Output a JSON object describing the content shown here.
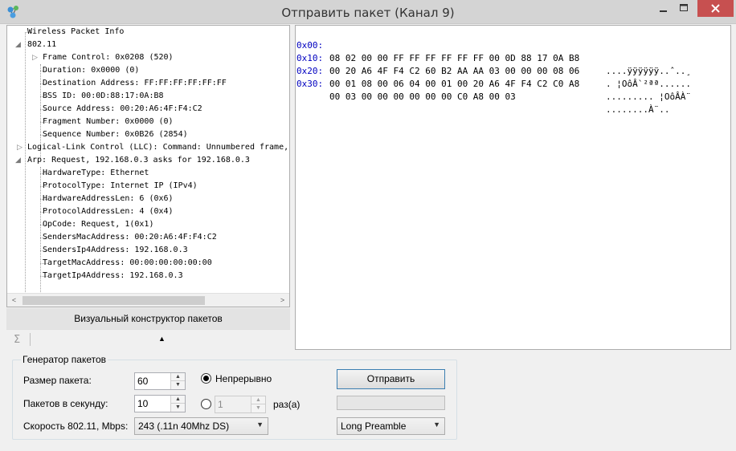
{
  "window": {
    "title": "Отправить пакет (Канал 9)",
    "minimize_glyph": "—",
    "maximize_glyph": "☐",
    "close_glyph": "✕"
  },
  "tree": {
    "nodes": [
      {
        "text": "Wireless Packet Info"
      },
      {
        "text": "802.11"
      },
      {
        "text": "Frame Control: 0x0208 (520)"
      },
      {
        "text": "Duration: 0x0000 (0)"
      },
      {
        "text": "Destination Address: FF:FF:FF:FF:FF:FF"
      },
      {
        "text": "BSS ID: 00:0D:88:17:0A:B8"
      },
      {
        "text": "Source Address: 00:20:A6:4F:F4:C2"
      },
      {
        "text": "Fragment Number: 0x0000 (0)"
      },
      {
        "text": "Sequence Number: 0x0B26 (2854)"
      },
      {
        "text": "Logical-Link Control (LLC): Command: Unnumbered frame,"
      },
      {
        "text": "Arp: Request, 192.168.0.3 asks for 192.168.0.3"
      },
      {
        "text": "HardwareType: Ethernet"
      },
      {
        "text": "ProtocolType: Internet IP (IPv4)"
      },
      {
        "text": "HardwareAddressLen: 6 (0x6)"
      },
      {
        "text": "ProtocolAddressLen: 4 (0x4)"
      },
      {
        "text": "OpCode: Request, 1(0x1)"
      },
      {
        "text": "SendersMacAddress: 00:20:A6:4F:F4:C2"
      },
      {
        "text": "SendersIp4Address: 192.168.0.3"
      },
      {
        "text": "TargetMacAddress: 00:00:00:00:00:00"
      },
      {
        "text": "TargetIp4Address: 192.168.0.3"
      }
    ],
    "scroll_left_glyph": "<",
    "scroll_right_glyph": ">"
  },
  "constructor": {
    "label": "Визуальный конструктор пакетов",
    "sigma": "Σ",
    "arrow": "▲"
  },
  "hex": {
    "rows": [
      {
        "offset": "0x00:",
        "bytes": "08 02 00 00 FF FF FF FF FF FF 00 0D 88 17 0A B8",
        "ascii": "....ÿÿÿÿÿÿ..ˆ..¸"
      },
      {
        "offset": "0x10:",
        "bytes": "00 20 A6 4F F4 C2 60 B2 AA AA 03 00 00 00 08 06",
        "ascii": ". ¦OôÂ`²ªª......"
      },
      {
        "offset": "0x20:",
        "bytes": "00 01 08 00 06 04 00 01 00 20 A6 4F F4 C2 C0 A8",
        "ascii": "......... ¦OôÂÀ¨"
      },
      {
        "offset": "0x30:",
        "bytes": "00 03 00 00 00 00 00 00 C0 A8 00 03",
        "ascii": "........À¨.."
      }
    ]
  },
  "generator": {
    "title": "Генератор пакетов",
    "packet_size_label": "Размер пакета:",
    "packet_size_value": "60",
    "pps_label": "Пакетов в секунду:",
    "pps_value": "10",
    "speed_label": "Скорость 802.11, Mbps:",
    "speed_value": "243 (.11n 40Mhz DS)",
    "continuous_label": "Непрерывно",
    "continuous_selected": true,
    "count_value": "1",
    "count_suffix": "раз(а)",
    "send_label": "Отправить",
    "progress_percent": 0,
    "preamble_value": "Long Preamble",
    "spin_up_glyph": "▲",
    "spin_down_glyph": "▼",
    "combo_arrow_glyph": "▼"
  },
  "colors": {
    "hex_offset": "#0000c0",
    "close_button": "#c75050",
    "send_border": "#3c7fb1"
  }
}
